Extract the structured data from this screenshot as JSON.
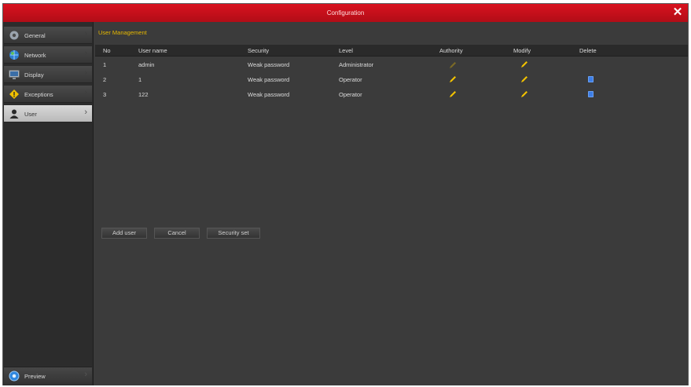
{
  "window": {
    "title": "Configuration"
  },
  "sidebar": {
    "items": [
      {
        "label": "General",
        "icon": "gear-icon"
      },
      {
        "label": "Network",
        "icon": "globe-icon"
      },
      {
        "label": "Display",
        "icon": "monitor-icon"
      },
      {
        "label": "Exceptions",
        "icon": "warning-icon"
      },
      {
        "label": "User",
        "icon": "user-icon",
        "active": true
      }
    ],
    "preview_label": "Preview"
  },
  "main": {
    "section_title": "User Management",
    "columns": [
      "No",
      "User name",
      "Security",
      "Level",
      "Authority",
      "Modify",
      "Delete"
    ],
    "rows": [
      {
        "no": "1",
        "user": "admin",
        "security": "Weak password",
        "level": "Administrator"
      },
      {
        "no": "2",
        "user": "1",
        "security": "Weak password",
        "level": "Operator"
      },
      {
        "no": "3",
        "user": "122",
        "security": "Weak password",
        "level": "Operator"
      }
    ],
    "buttons": {
      "add": "Add user",
      "cancel": "Cancel",
      "security": "Security set"
    }
  },
  "colors": {
    "titlebar": "#c8101c",
    "accent": "#e6b800",
    "edit": "#f2c200",
    "delete": "#3d7ee6"
  }
}
